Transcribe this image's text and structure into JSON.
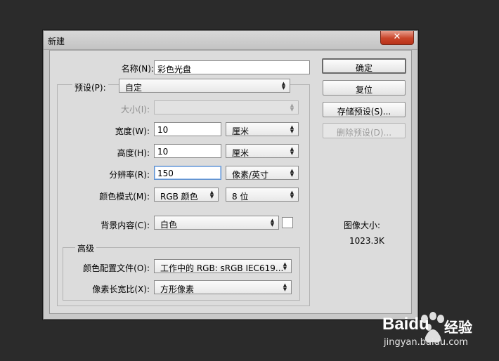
{
  "window": {
    "title": "新建",
    "close_glyph": "✕"
  },
  "form": {
    "name_label": "名称(N):",
    "name_value": "彩色光盘",
    "preset_label": "预设(P):",
    "preset_value": "自定",
    "size_label": "大小(I):",
    "size_value": "",
    "width_label": "宽度(W):",
    "width_value": "10",
    "width_unit": "厘米",
    "height_label": "高度(H):",
    "height_value": "10",
    "height_unit": "厘米",
    "resolution_label": "分辨率(R):",
    "resolution_value": "150",
    "resolution_unit": "像素/英寸",
    "colormode_label": "颜色模式(M):",
    "colormode_value": "RGB 颜色",
    "bitdepth_value": "8 位",
    "background_label": "背景内容(C):",
    "background_value": "白色"
  },
  "advanced": {
    "title": "高级",
    "profile_label": "颜色配置文件(O):",
    "profile_value": "工作中的 RGB: sRGB IEC619...",
    "pixel_aspect_label": "像素长宽比(X):",
    "pixel_aspect_value": "方形像素"
  },
  "buttons": {
    "ok": "确定",
    "reset": "复位",
    "save_preset": "存储预设(S)...",
    "delete_preset": "删除预设(D)..."
  },
  "info": {
    "image_size_label": "图像大小:",
    "image_size_value": "1023.3K"
  },
  "watermark": {
    "brand": "Baidu",
    "brand_cn": "经验",
    "url": "jingyan.baidu.com"
  }
}
